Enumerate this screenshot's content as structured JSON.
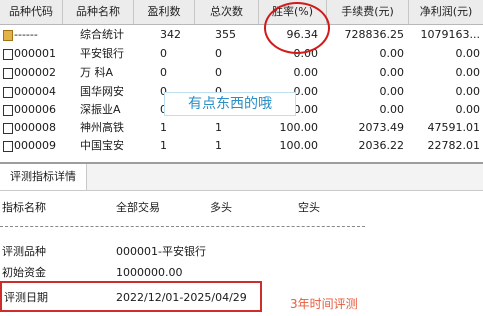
{
  "grid": {
    "headers": [
      "品种代码",
      "品种名称",
      "盈利数",
      "总次数",
      "胜率(%)",
      "手续费(元)",
      "净利润(元)"
    ],
    "rows": [
      {
        "code": "------",
        "name": "综合统计",
        "wins": "342",
        "total": "355",
        "winrate": "96.34",
        "fee": "728836.25",
        "profit": "1079163..."
      },
      {
        "code": "000001",
        "name": "平安银行",
        "wins": "0",
        "total": "0",
        "winrate": "0.00",
        "fee": "0.00",
        "profit": "0.00"
      },
      {
        "code": "000002",
        "name": "万 科A",
        "wins": "0",
        "total": "0",
        "winrate": "0.00",
        "fee": "0.00",
        "profit": "0.00"
      },
      {
        "code": "000004",
        "name": "国华网安",
        "wins": "0",
        "total": "0",
        "winrate": "0.00",
        "fee": "0.00",
        "profit": "0.00"
      },
      {
        "code": "000006",
        "name": "深振业A",
        "wins": "0",
        "total": "0",
        "winrate": "0.00",
        "fee": "0.00",
        "profit": "0.00"
      },
      {
        "code": "000008",
        "name": "神州高铁",
        "wins": "1",
        "total": "1",
        "winrate": "100.00",
        "fee": "2073.49",
        "profit": "47591.01"
      },
      {
        "code": "000009",
        "name": "中国宝安",
        "wins": "1",
        "total": "1",
        "winrate": "100.00",
        "fee": "2036.22",
        "profit": "22782.01"
      }
    ]
  },
  "overlay_annotation": "有点东西的哦",
  "tab": {
    "label": "评测指标详情"
  },
  "detail": {
    "headers": [
      "指标名称",
      "全部交易",
      "多头",
      "空头"
    ],
    "rows": [
      {
        "label": "评测品种",
        "value": "000001-平安银行"
      },
      {
        "label": "初始资金",
        "value": "1000000.00"
      },
      {
        "label": "评测日期",
        "value": "2022/12/01-2025/04/29"
      }
    ]
  },
  "footer_annotation": "3年时间评测",
  "colors": {
    "annotation_red": "#d21a1a",
    "annotation_blue": "#2a8fc6"
  }
}
